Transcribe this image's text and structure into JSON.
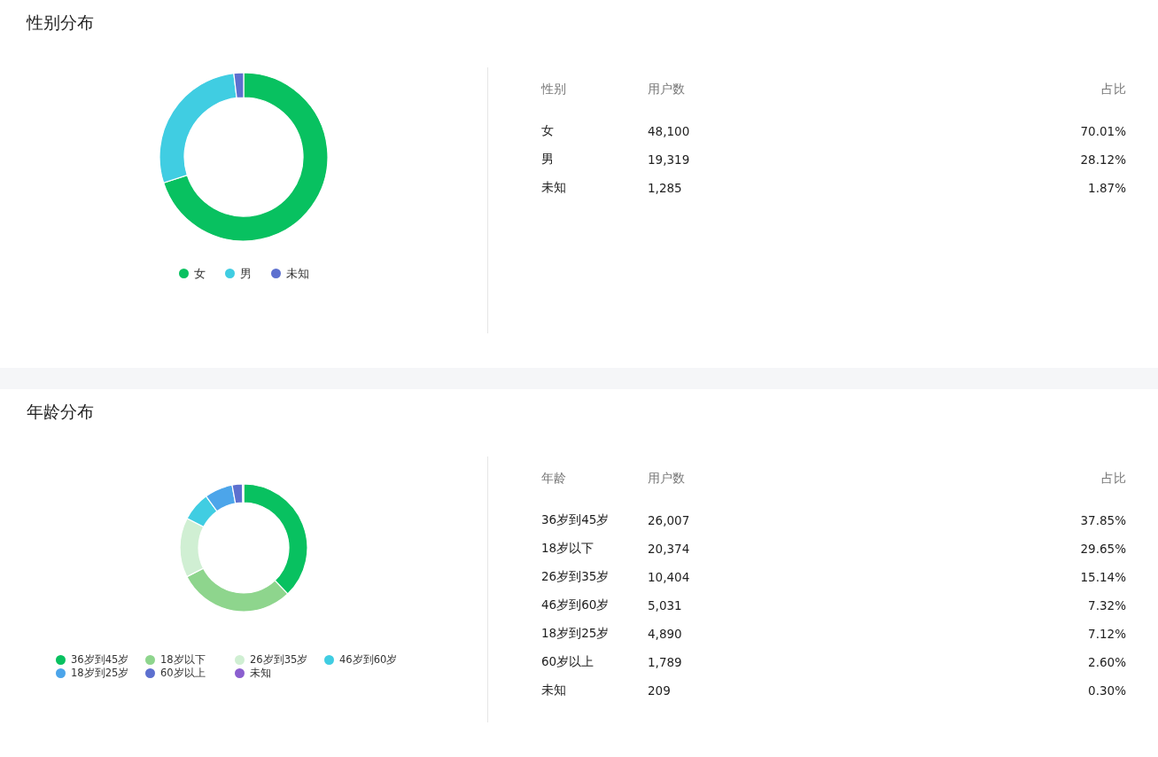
{
  "sections": [
    {
      "title": "性别分布",
      "chart_data": {
        "type": "donut",
        "categories": [
          "女",
          "男",
          "未知"
        ],
        "series": [
          {
            "values": [
              70.01,
              28.12,
              1.87
            ]
          }
        ]
      },
      "legend": [
        {
          "color": "#08c160"
        },
        {
          "color": "#40cde2"
        },
        {
          "color": "#5d70cf"
        }
      ],
      "table": {
        "columns": [
          "性别",
          "用户数",
          "占比"
        ],
        "rows": [
          [
            "女",
            "48,100",
            "70.01%"
          ],
          [
            "男",
            "19,319",
            "28.12%"
          ],
          [
            "未知",
            "1,285",
            "1.87%"
          ]
        ]
      }
    },
    {
      "title": "年龄分布",
      "chart_data": {
        "type": "donut",
        "categories": [
          "36岁到45岁",
          "18岁以下",
          "26岁到35岁",
          "46岁到60岁",
          "18岁到25岁",
          "60岁以上",
          "未知"
        ],
        "series": [
          {
            "values": [
              37.85,
              29.65,
              15.14,
              7.32,
              7.12,
              2.6,
              0.3
            ]
          }
        ]
      },
      "legend": [
        {
          "color": "#08c160"
        },
        {
          "color": "#8ed58d"
        },
        {
          "color": "#d0efd3"
        },
        {
          "color": "#40cde2"
        },
        {
          "color": "#4ca5ea"
        },
        {
          "color": "#5d70cf"
        },
        {
          "color": "#8b5fcf"
        }
      ],
      "table": {
        "columns": [
          "年龄",
          "用户数",
          "占比"
        ],
        "rows": [
          [
            "36岁到45岁",
            "26,007",
            "37.85%"
          ],
          [
            "18岁以下",
            "20,374",
            "29.65%"
          ],
          [
            "26岁到35岁",
            "10,404",
            "15.14%"
          ],
          [
            "46岁到60岁",
            "5,031",
            "7.32%"
          ],
          [
            "18岁到25岁",
            "4,890",
            "7.12%"
          ],
          [
            "60岁以上",
            "1,789",
            "2.60%"
          ],
          [
            "未知",
            "209",
            "0.30%"
          ]
        ]
      }
    }
  ]
}
